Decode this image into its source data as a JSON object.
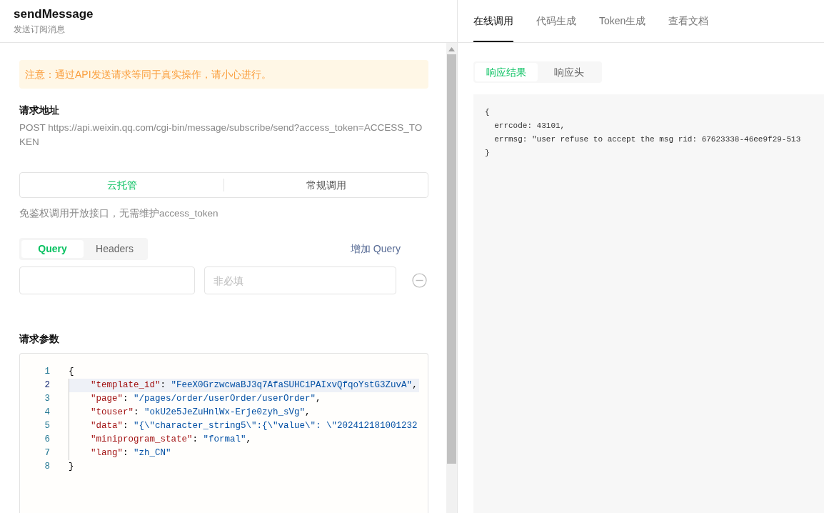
{
  "header": {
    "title": "sendMessage",
    "subtitle": "发送订阅消息"
  },
  "warning": "注意：通过API发送请求等同于真实操作，请小心进行。",
  "request_url": {
    "label": "请求地址",
    "value": "POST https://api.weixin.qq.com/cgi-bin/message/subscribe/send?access_token=ACCESS_TOKEN"
  },
  "call_modes": [
    {
      "label": "云托管",
      "selected": true
    },
    {
      "label": "常规调用",
      "selected": false
    }
  ],
  "call_mode_note": "免鉴权调用开放接口，无需维护access_token",
  "param_tabs": [
    {
      "label": "Query",
      "selected": true
    },
    {
      "label": "Headers",
      "selected": false
    }
  ],
  "add_query": "增加 Query",
  "query_row": {
    "value_placeholder": "非必填"
  },
  "request_params": {
    "label": "请求参数",
    "lines": [
      {
        "number": "1",
        "text": "{",
        "active": false
      },
      {
        "number": "2",
        "text": "    \"template_id\": \"FeeX0GrzwcwaBJ3q7AfaSUHCiPAIxvQfqoYstG3ZuvA\",",
        "active": true
      },
      {
        "number": "3",
        "text": "    \"page\": \"/pages/order/userOrder/userOrder\",",
        "active": false
      },
      {
        "number": "4",
        "text": "    \"touser\": \"okU2e5JeZuHnlWx-Erje0zyh_sVg\",",
        "active": false
      },
      {
        "number": "5",
        "text": "    \"data\": \"{\\\"character_string5\\\":{\\\"value\\\": \\\"202412181001232",
        "active": false
      },
      {
        "number": "6",
        "text": "    \"miniprogram_state\": \"formal\",",
        "active": false
      },
      {
        "number": "7",
        "text": "    \"lang\": \"zh_CN\"",
        "active": false
      },
      {
        "number": "8",
        "text": "}",
        "active": false
      }
    ]
  },
  "main_tabs": [
    {
      "label": "在线调用",
      "selected": true
    },
    {
      "label": "代码生成",
      "selected": false
    },
    {
      "label": "Token生成",
      "selected": false
    },
    {
      "label": "查看文档",
      "selected": false
    }
  ],
  "response_tabs": [
    {
      "label": "响应结果",
      "selected": true
    },
    {
      "label": "响应头",
      "selected": false
    }
  ],
  "response_lines": [
    "{",
    "  errcode: 43101,",
    "  errmsg: \"user refuse to accept the msg rid: 67623338-46ee9f29-513",
    "}"
  ]
}
